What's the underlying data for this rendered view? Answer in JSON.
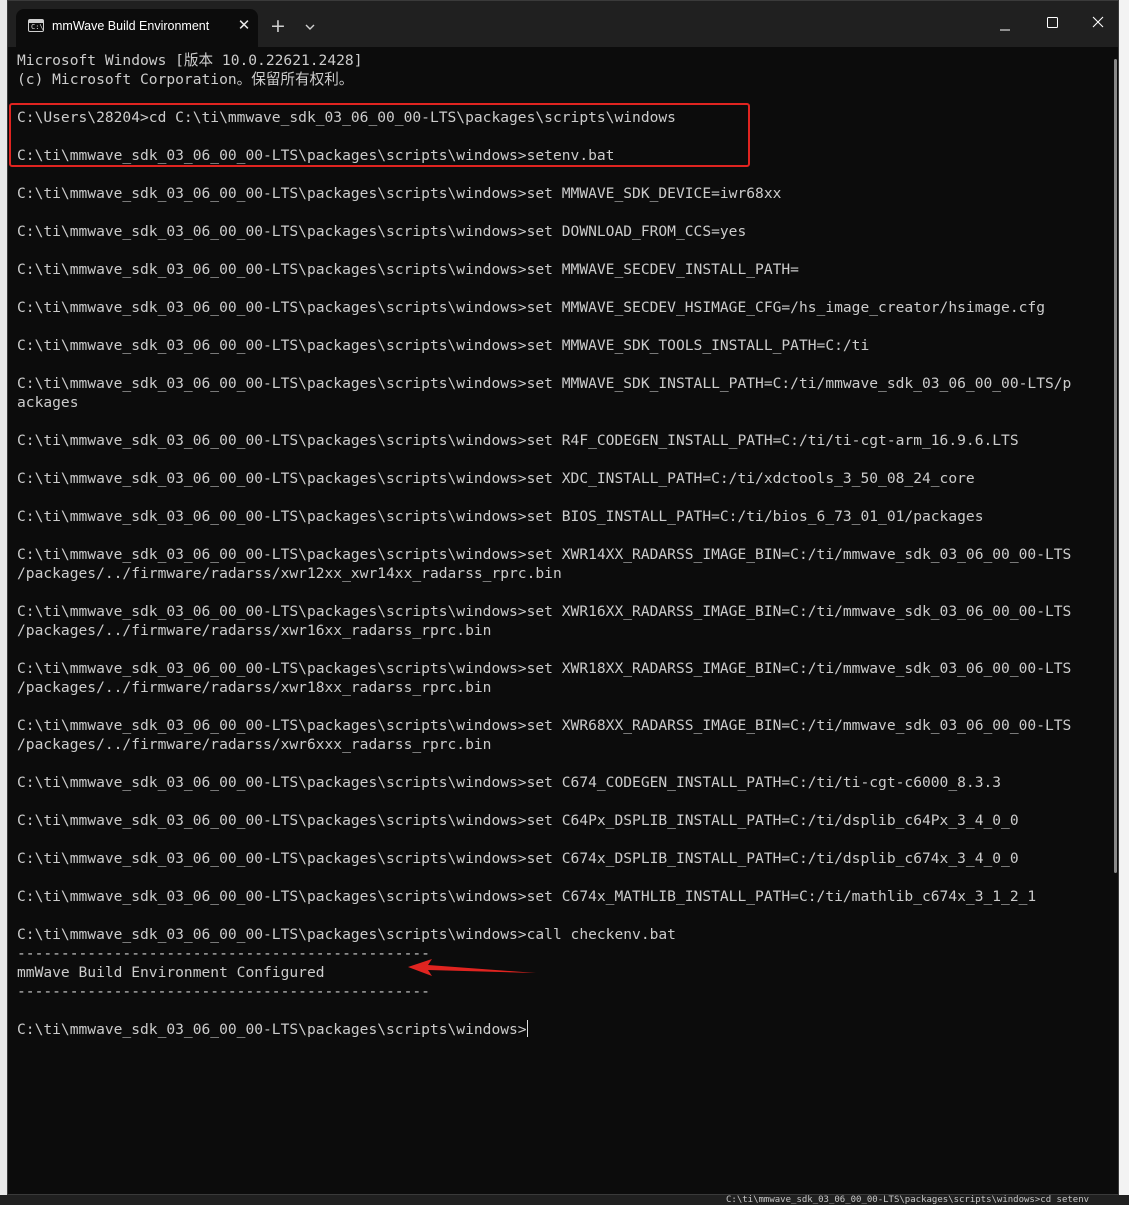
{
  "window": {
    "tab_title": "mmWave Build Environment",
    "tab_icon": "terminal-icon",
    "close_tab_glyph": "✕",
    "new_tab_glyph": "+",
    "dropdown_icon": "chevron-down-icon",
    "minimize_icon": "minimize-icon",
    "maximize_icon": "maximize-icon",
    "close_icon": "close-icon"
  },
  "terminal": {
    "lines": [
      "Microsoft Windows [版本 10.0.22621.2428]",
      "(c) Microsoft Corporation。保留所有权利。",
      "",
      "C:\\Users\\28204>cd C:\\ti\\mmwave_sdk_03_06_00_00-LTS\\packages\\scripts\\windows",
      "",
      "C:\\ti\\mmwave_sdk_03_06_00_00-LTS\\packages\\scripts\\windows>setenv.bat",
      "",
      "C:\\ti\\mmwave_sdk_03_06_00_00-LTS\\packages\\scripts\\windows>set MMWAVE_SDK_DEVICE=iwr68xx",
      "",
      "C:\\ti\\mmwave_sdk_03_06_00_00-LTS\\packages\\scripts\\windows>set DOWNLOAD_FROM_CCS=yes",
      "",
      "C:\\ti\\mmwave_sdk_03_06_00_00-LTS\\packages\\scripts\\windows>set MMWAVE_SECDEV_INSTALL_PATH=",
      "",
      "C:\\ti\\mmwave_sdk_03_06_00_00-LTS\\packages\\scripts\\windows>set MMWAVE_SECDEV_HSIMAGE_CFG=/hs_image_creator/hsimage.cfg",
      "",
      "C:\\ti\\mmwave_sdk_03_06_00_00-LTS\\packages\\scripts\\windows>set MMWAVE_SDK_TOOLS_INSTALL_PATH=C:/ti",
      "",
      "C:\\ti\\mmwave_sdk_03_06_00_00-LTS\\packages\\scripts\\windows>set MMWAVE_SDK_INSTALL_PATH=C:/ti/mmwave_sdk_03_06_00_00-LTS/p",
      "ackages",
      "",
      "C:\\ti\\mmwave_sdk_03_06_00_00-LTS\\packages\\scripts\\windows>set R4F_CODEGEN_INSTALL_PATH=C:/ti/ti-cgt-arm_16.9.6.LTS",
      "",
      "C:\\ti\\mmwave_sdk_03_06_00_00-LTS\\packages\\scripts\\windows>set XDC_INSTALL_PATH=C:/ti/xdctools_3_50_08_24_core",
      "",
      "C:\\ti\\mmwave_sdk_03_06_00_00-LTS\\packages\\scripts\\windows>set BIOS_INSTALL_PATH=C:/ti/bios_6_73_01_01/packages",
      "",
      "C:\\ti\\mmwave_sdk_03_06_00_00-LTS\\packages\\scripts\\windows>set XWR14XX_RADARSS_IMAGE_BIN=C:/ti/mmwave_sdk_03_06_00_00-LTS",
      "/packages/../firmware/radarss/xwr12xx_xwr14xx_radarss_rprc.bin",
      "",
      "C:\\ti\\mmwave_sdk_03_06_00_00-LTS\\packages\\scripts\\windows>set XWR16XX_RADARSS_IMAGE_BIN=C:/ti/mmwave_sdk_03_06_00_00-LTS",
      "/packages/../firmware/radarss/xwr16xx_radarss_rprc.bin",
      "",
      "C:\\ti\\mmwave_sdk_03_06_00_00-LTS\\packages\\scripts\\windows>set XWR18XX_RADARSS_IMAGE_BIN=C:/ti/mmwave_sdk_03_06_00_00-LTS",
      "/packages/../firmware/radarss/xwr18xx_radarss_rprc.bin",
      "",
      "C:\\ti\\mmwave_sdk_03_06_00_00-LTS\\packages\\scripts\\windows>set XWR68XX_RADARSS_IMAGE_BIN=C:/ti/mmwave_sdk_03_06_00_00-LTS",
      "/packages/../firmware/radarss/xwr6xxx_radarss_rprc.bin",
      "",
      "C:\\ti\\mmwave_sdk_03_06_00_00-LTS\\packages\\scripts\\windows>set C674_CODEGEN_INSTALL_PATH=C:/ti/ti-cgt-c6000_8.3.3",
      "",
      "C:\\ti\\mmwave_sdk_03_06_00_00-LTS\\packages\\scripts\\windows>set C64Px_DSPLIB_INSTALL_PATH=C:/ti/dsplib_c64Px_3_4_0_0",
      "",
      "C:\\ti\\mmwave_sdk_03_06_00_00-LTS\\packages\\scripts\\windows>set C674x_DSPLIB_INSTALL_PATH=C:/ti/dsplib_c674x_3_4_0_0",
      "",
      "C:\\ti\\mmwave_sdk_03_06_00_00-LTS\\packages\\scripts\\windows>set C674x_MATHLIB_INSTALL_PATH=C:/ti/mathlib_c674x_3_1_2_1",
      "",
      "C:\\ti\\mmwave_sdk_03_06_00_00-LTS\\packages\\scripts\\windows>call checkenv.bat",
      "-----------------------------------------------",
      "mmWave Build Environment Configured",
      "-----------------------------------------------",
      "",
      "C:\\ti\\mmwave_sdk_03_06_00_00-LTS\\packages\\scripts\\windows>"
    ]
  },
  "background_behind": {
    "bottom_text": "C:\\ti\\mmwave_sdk_03_06_00_00-LTS\\packages\\scripts\\windows>cd setenv"
  },
  "annotations": {
    "highlight_color": "#e02420",
    "arrow_color": "#e02420"
  },
  "colors": {
    "terminal_bg": "#0c0c0c",
    "terminal_fg": "#cccccc",
    "titlebar_bg": "#202020"
  }
}
